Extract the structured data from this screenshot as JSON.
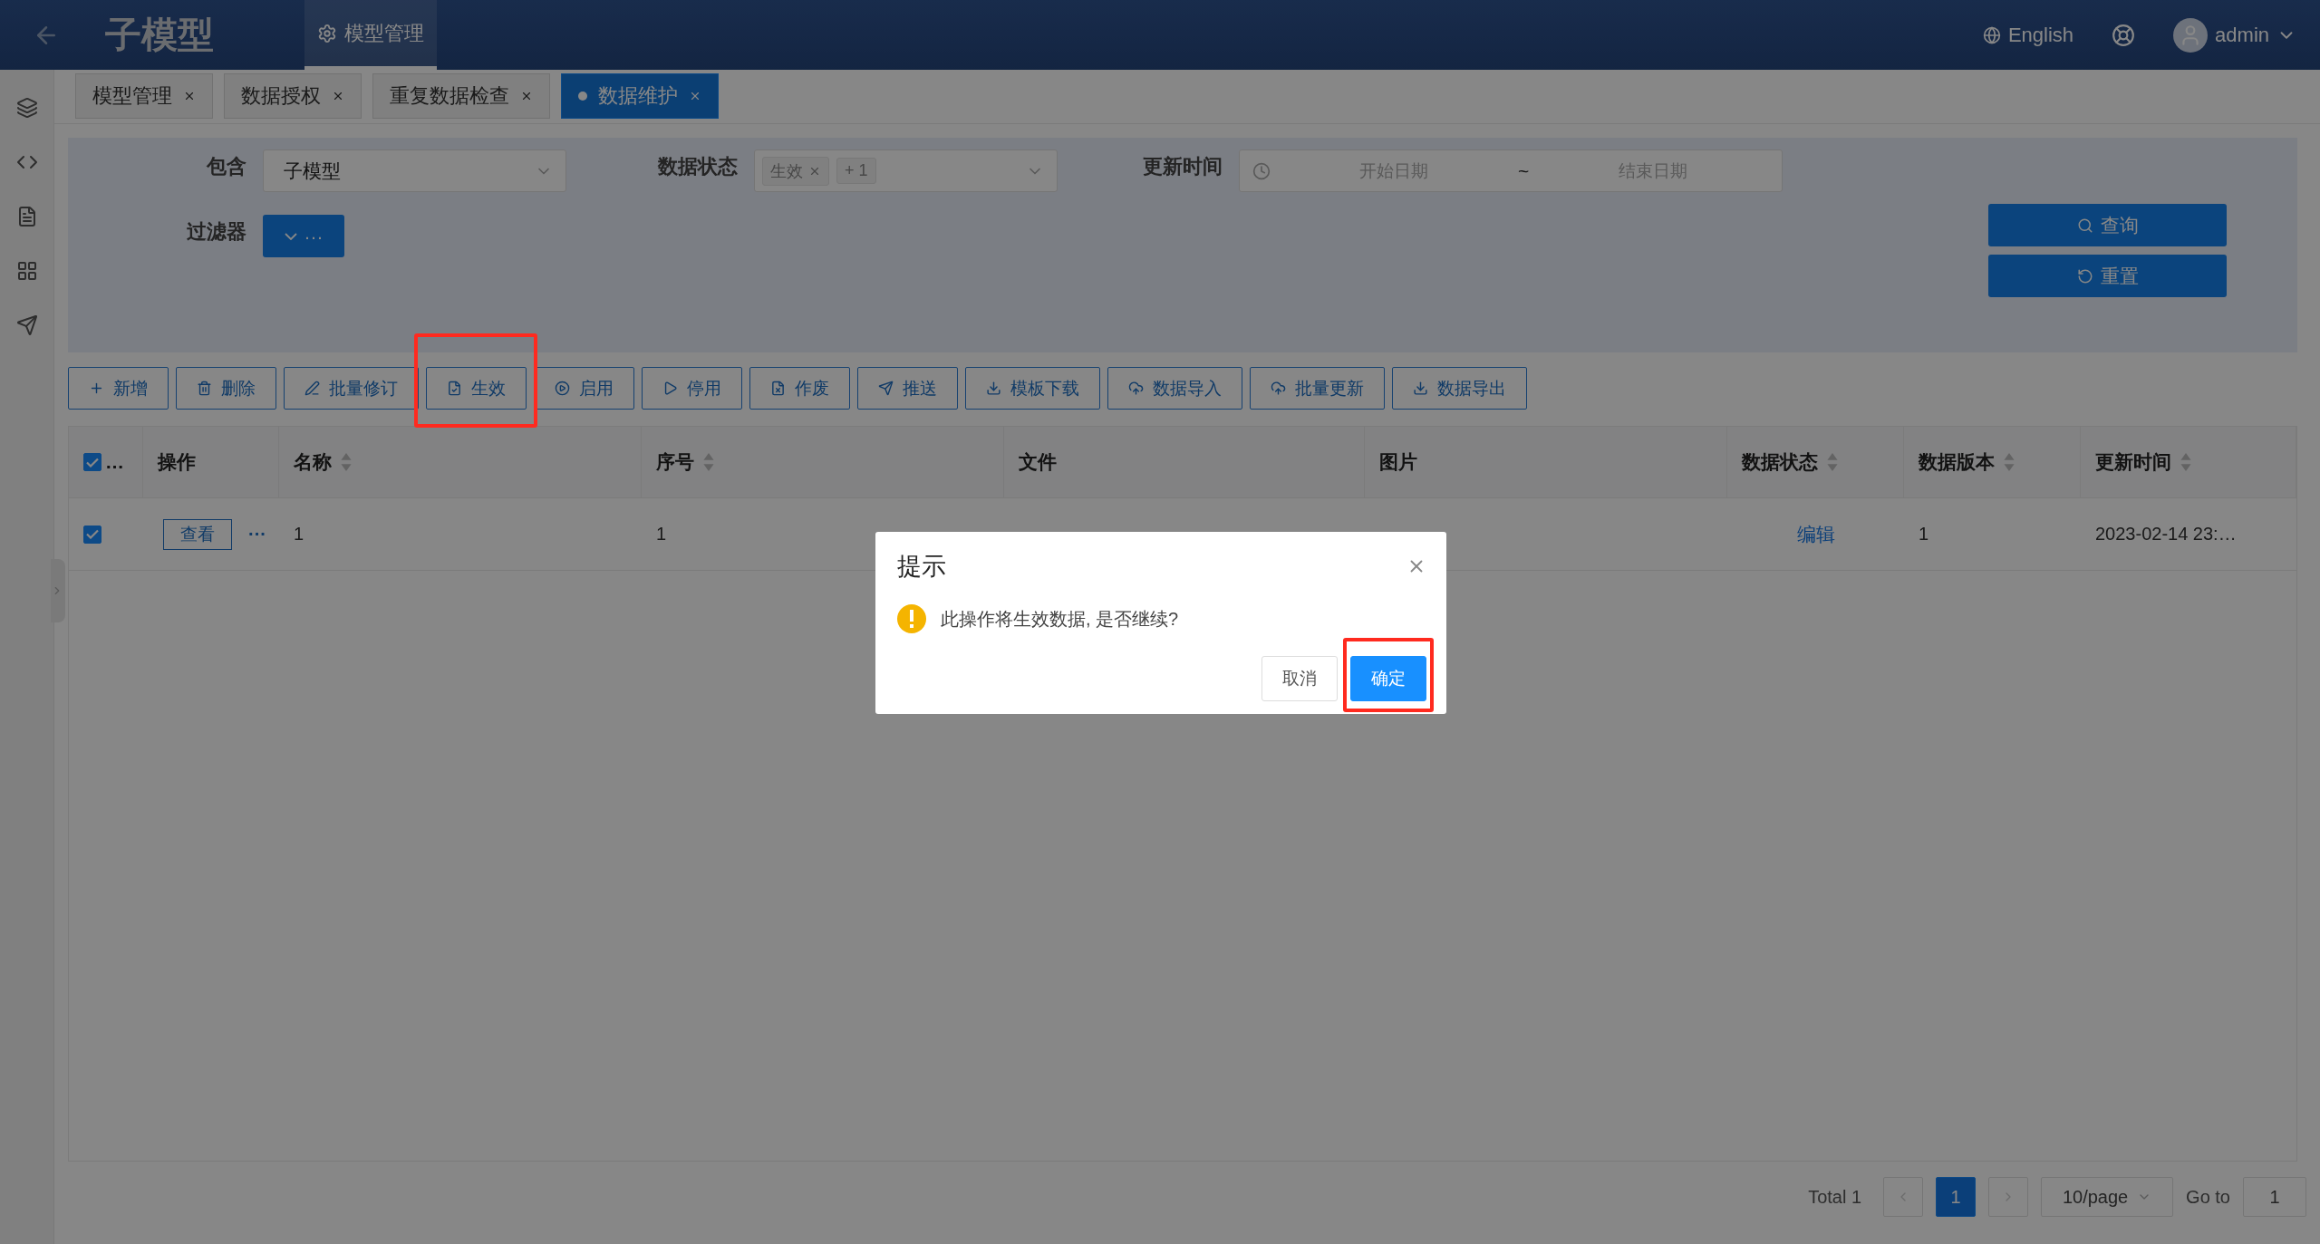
{
  "header": {
    "title": "子模型",
    "nav": [
      {
        "label": "模型管理",
        "selected": true
      }
    ],
    "language": "English",
    "user": "admin"
  },
  "tabs": [
    {
      "label": "模型管理",
      "selected": false
    },
    {
      "label": "数据授权",
      "selected": false
    },
    {
      "label": "重复数据检查",
      "selected": false
    },
    {
      "label": "数据维护",
      "selected": true
    }
  ],
  "filters": {
    "include": {
      "label": "包含",
      "value": "子模型"
    },
    "status": {
      "label": "数据状态",
      "tags": [
        "生效"
      ],
      "more": "+ 1"
    },
    "updated": {
      "label": "更新时间",
      "start_placeholder": "开始日期",
      "separator": "~",
      "end_placeholder": "结束日期"
    },
    "filter": {
      "label": "过滤器",
      "button": "···"
    },
    "buttons": [
      "查询",
      "重置"
    ]
  },
  "toolbar": [
    {
      "label": "新增",
      "highlighted": false
    },
    {
      "label": "删除",
      "highlighted": false
    },
    {
      "label": "批量修订",
      "highlighted": false
    },
    {
      "label": "生效",
      "highlighted": true
    },
    {
      "label": "启用",
      "highlighted": false
    },
    {
      "label": "停用",
      "highlighted": false
    },
    {
      "label": "作废",
      "highlighted": false
    },
    {
      "label": "推送",
      "highlighted": false
    },
    {
      "label": "模板下载",
      "highlighted": false
    },
    {
      "label": "数据导入",
      "highlighted": false
    },
    {
      "label": "批量更新",
      "highlighted": false
    },
    {
      "label": "数据导出",
      "highlighted": false
    }
  ],
  "table": {
    "select_all": {
      "checked": true,
      "label": "…"
    },
    "columns": [
      {
        "label": "操作",
        "sortable": false
      },
      {
        "label": "名称",
        "sortable": true
      },
      {
        "label": "序号",
        "sortable": true
      },
      {
        "label": "文件",
        "sortable": false
      },
      {
        "label": "图片",
        "sortable": false
      },
      {
        "label": "数据状态",
        "sortable": true
      },
      {
        "label": "数据版本",
        "sortable": true
      },
      {
        "label": "更新时间",
        "sortable": true
      }
    ],
    "rows": [
      {
        "checked": true,
        "cells": [
          {
            "kind": "action",
            "text": "查看",
            "more": "···"
          },
          {
            "kind": "text",
            "text": "1"
          },
          {
            "kind": "text",
            "text": "1"
          },
          {
            "kind": "empty"
          },
          {
            "kind": "empty"
          },
          {
            "kind": "link",
            "text": "编辑"
          },
          {
            "kind": "text",
            "text": "1"
          },
          {
            "kind": "text",
            "text": "2023-02-14 23:…"
          }
        ]
      }
    ]
  },
  "pagination": {
    "total": "Total 1",
    "pages": [
      {
        "label": "1",
        "selected": true
      }
    ],
    "page_size": "10/page",
    "goto_label": "Go to",
    "goto_value": "1"
  },
  "dialog": {
    "title": "提示",
    "message": "此操作将生效数据, 是否继续?",
    "buttons": [
      {
        "label": "取消",
        "kind": "default",
        "highlighted": false
      },
      {
        "label": "确定",
        "kind": "primary",
        "highlighted": true
      }
    ]
  }
}
